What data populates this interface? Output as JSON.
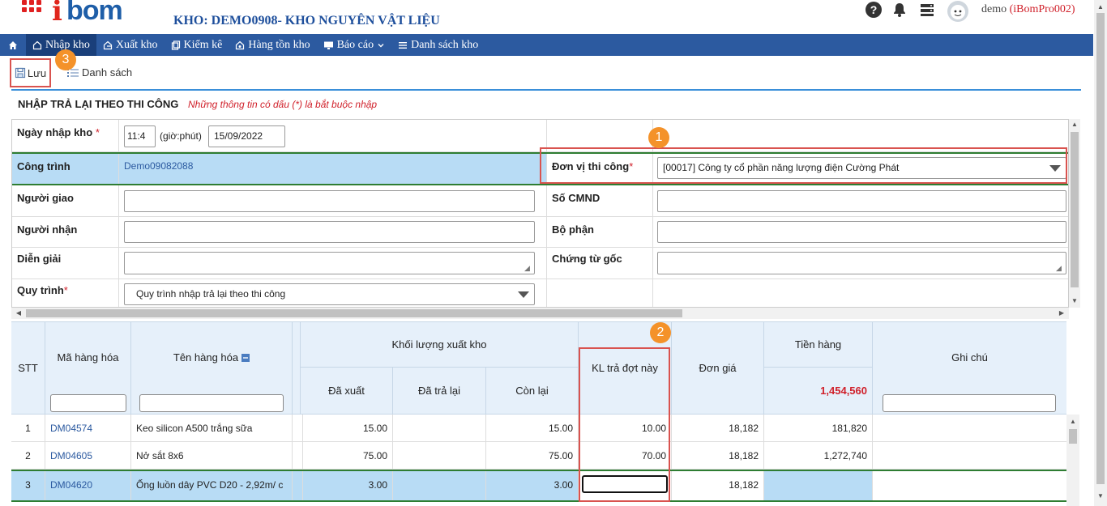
{
  "header": {
    "logo_i": "i",
    "logo_bom": "bom",
    "kho_title": "KHO: DEMO0908- KHO NGUYÊN VẬT LIỆU",
    "help_glyph": "?",
    "user_name": "demo",
    "user_account": "(iBomPro002)"
  },
  "nav": {
    "items": [
      "Nhập kho",
      "Xuất kho",
      "Kiểm kê",
      "Hàng tồn kho",
      "Báo cáo",
      "Danh sách kho"
    ]
  },
  "toolbar": {
    "save_label": "Lưu",
    "list_label": "Danh sách"
  },
  "badges": [
    "1",
    "2",
    "3"
  ],
  "form": {
    "title": "NHẬP TRẢ LẠI THEO THI CÔNG",
    "note": "Những thông tin có dấu (*) là bắt buộc nhập",
    "ngay_label": "Ngày nhập kho",
    "time_value": "11:4",
    "time_hint": "(giờ:phút)",
    "date_value": "15/09/2022",
    "cong_trinh_label": "Công trình",
    "cong_trinh_value": "Demo09082088",
    "don_vi_label": "Đơn vị thi công",
    "don_vi_value": "[00017] Công ty cổ phần năng lượng điện Cường Phát",
    "nguoi_giao_label": "Người giao",
    "so_cmnd_label": "Số CMND",
    "nguoi_nhan_label": "Người nhận",
    "bo_phan_label": "Bộ phận",
    "dien_giai_label": "Diễn giải",
    "chung_tu_label": "Chứng từ gốc",
    "quy_trinh_label": "Quy trình",
    "quy_trinh_value": "Quy trình nhập trả lại theo thi công",
    "required_mark": "*"
  },
  "grid": {
    "headers": {
      "stt": "STT",
      "ma_hang": "Mã hàng hóa",
      "ten_hang": "Tên hàng hóa",
      "khoi_luong": "Khối lượng xuất kho",
      "da_xuat": "Đã xuất",
      "da_tra_lai": "Đã trả lại",
      "con_lai": "Còn lại",
      "kl_tra": "KL trả đợt này",
      "don_gia": "Đơn giá",
      "tien_hang": "Tiền hàng",
      "ghi_chu": "Ghi chú"
    },
    "total_tien_hang": "1,454,560",
    "rows": [
      {
        "stt": "1",
        "ma": "DM04574",
        "ten": "Keo silicon A500 trắng sữa",
        "da_xuat": "15.00",
        "da_tra_lai": "",
        "con_lai": "15.00",
        "kl_tra": "10.00",
        "don_gia": "18,182",
        "tien_hang": "181,820",
        "ghi_chu": ""
      },
      {
        "stt": "2",
        "ma": "DM04605",
        "ten": "Nở sắt 8x6",
        "da_xuat": "75.00",
        "da_tra_lai": "",
        "con_lai": "75.00",
        "kl_tra": "70.00",
        "don_gia": "18,182",
        "tien_hang": "1,272,740",
        "ghi_chu": ""
      },
      {
        "stt": "3",
        "ma": "DM04620",
        "ten": "Ống luồn dây PVC D20 - 2,92m/ c",
        "da_xuat": "3.00",
        "da_tra_lai": "",
        "con_lai": "3.00",
        "kl_tra": "",
        "don_gia": "18,182",
        "tien_hang": "",
        "ghi_chu": ""
      }
    ]
  },
  "colors": {
    "nav_bg": "#2c5aa0",
    "accent_red": "#d0202a",
    "badge_orange": "#f4922a",
    "highlight_row": "#b8dcf5",
    "annotation_red": "#d9534f"
  }
}
